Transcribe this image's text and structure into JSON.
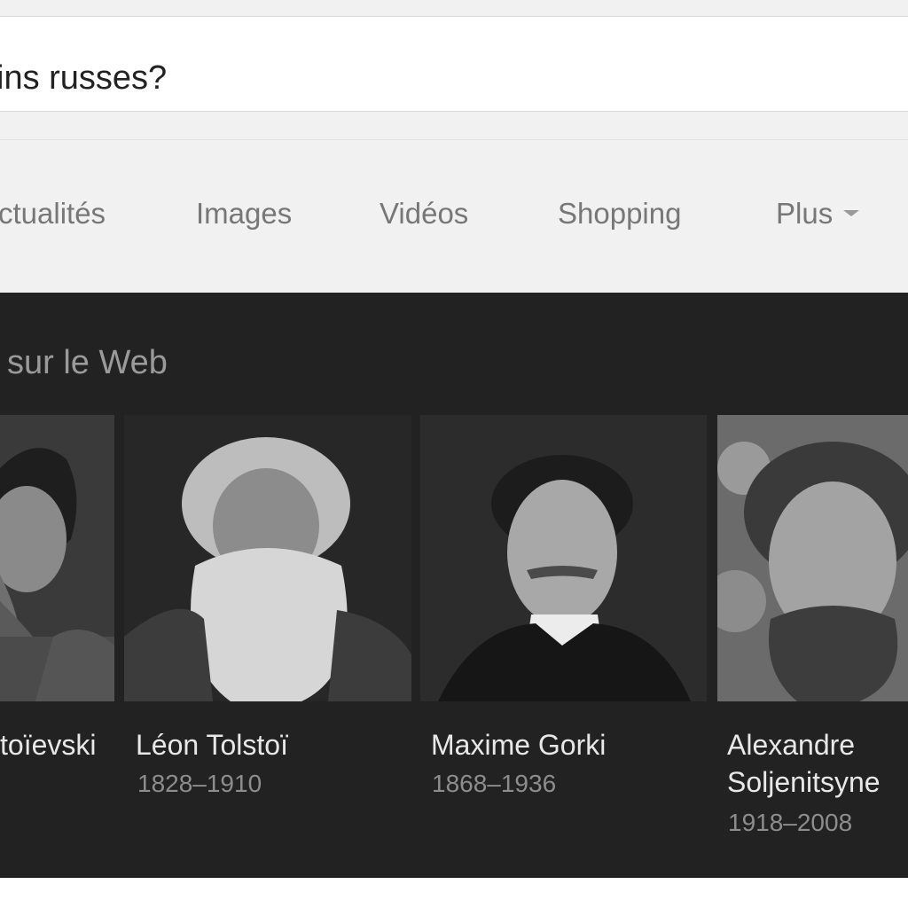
{
  "search": {
    "query": "ins russes?"
  },
  "tabs": [
    {
      "label": "ctualités"
    },
    {
      "label": "Images"
    },
    {
      "label": "Vidéos"
    },
    {
      "label": "Shopping"
    },
    {
      "label": "Plus"
    }
  ],
  "carousel": {
    "title": "sur le Web",
    "items": [
      {
        "name": "toïevski",
        "dates": ""
      },
      {
        "name": "Léon Tolstoï",
        "dates": "1828–1910"
      },
      {
        "name": "Maxime Gorki",
        "dates": "1868–1936"
      },
      {
        "name_line1": "Alexandre",
        "name_line2": "Soljenitsyne",
        "dates": "1918–2008"
      }
    ]
  },
  "icons": {
    "more_caret": "caret-down-icon"
  },
  "colors": {
    "panel_bg": "#222222",
    "page_bg": "#f1f1f1",
    "tab_text": "#777777"
  }
}
